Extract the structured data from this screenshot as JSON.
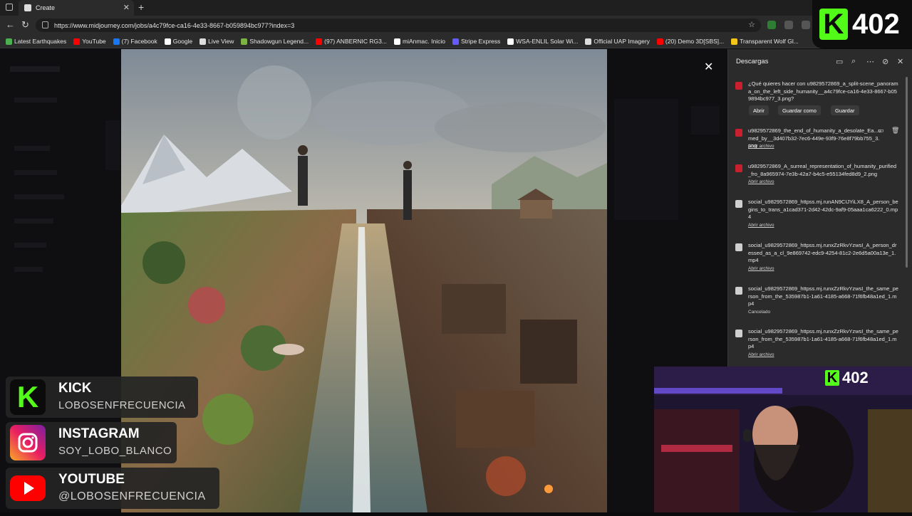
{
  "browser": {
    "tab_title": "Create",
    "url": "https://www.midjourney.com/jobs/a4c79fce-ca16-4e33-8667-b059894bc977?index=3",
    "bookmarks": [
      {
        "label": "Latest Earthquakes",
        "color": "#4caf50"
      },
      {
        "label": "YouTube",
        "color": "#ff0000"
      },
      {
        "label": "(7) Facebook",
        "color": "#1877f2"
      },
      {
        "label": "Google",
        "color": "#ffffff"
      },
      {
        "label": "Live View",
        "color": "#dddddd"
      },
      {
        "label": "Shadowgun Legend...",
        "color": "#7cb342"
      },
      {
        "label": "(97) ANBERNIC RG3...",
        "color": "#ff0000"
      },
      {
        "label": "miAnmac. Inicio",
        "color": "#ffffff"
      },
      {
        "label": "Stripe Express",
        "color": "#635bff"
      },
      {
        "label": "WSA-ENLIL Solar Wi...",
        "color": "#ffffff"
      },
      {
        "label": "Official UAP Imagery",
        "color": "#dddddd"
      },
      {
        "label": "(20) Demo 3D[SBS]...",
        "color": "#ff0000"
      },
      {
        "label": "Transparent Wolf Gl...",
        "color": "#f5c518"
      }
    ]
  },
  "overlay_top_right": {
    "count": "402",
    "letter": "K"
  },
  "downloads": {
    "title": "Descargas",
    "items": [
      {
        "name": "¿Qué quieres hacer con u9829572869_a_split-scene_panorama_on_the_left_side_humanity__a4c79fce-ca16-4e33-8667-b059894bc977_3.png?",
        "buttons": [
          "Abrir",
          "Guardar como",
          "Guardar"
        ]
      },
      {
        "name": "u9829572869_the_end_of_humanity_a_desolate_Ea...umed_by__3d407b32-7ec6-449e-93f9-76e8f79bb755_3.png",
        "sub": "Abrir archivo"
      },
      {
        "name": "u9829572869_A_surreal_representation_of_humanity_purified_fro_8a965974-7e3b-42a7-b4c5-e55134fed8d9_2.png",
        "sub": "Abrir archivo"
      },
      {
        "name": "social_u9829572869_httpss.mj.runAN9CIJYiLX8_A_person_begins_to_trans_a1cad371-2d42-42dc-9af9-05aaa1ca6222_0.mp4",
        "sub": "Abrir archivo"
      },
      {
        "name": "social_u9829572869_httpss.mj.runxZzRkvYzwsI_A_person_dressed_as_a_cl_9e869742-edc9-4254-81c2-2e6d5a00a13e_1.mp4",
        "sub": "Abrir archivo"
      },
      {
        "name": "social_u9829572869_httpss.mj.runxZzRkvYzwsI_the_same_person_from_the_535987b1-1a61-4185-a668-71f6fb48a1ed_1.mp4",
        "sub": "Cancelado"
      },
      {
        "name": "social_u9829572869_httpss.mj.runxZzRkvYzwsI_the_same_person_from_the_535987b1-1a61-4185-a668-71f6fb48a1ed_1.mp4",
        "sub": "Abrir archivo"
      }
    ]
  },
  "social": [
    {
      "platform": "KICK",
      "handle": "LOBOSENFRECUENCIA"
    },
    {
      "platform": "INSTAGRAM",
      "handle": "SOY_LOBO_BLANCO"
    },
    {
      "platform": "YOUTUBE",
      "handle": "@LOBOSENFRECUENCIA"
    }
  ],
  "webcam_tag": {
    "letter": "K",
    "count": "402"
  },
  "colors": {
    "kick_green": "#53fc18",
    "panel": "#2b2b2b",
    "youtube_red": "#ff0000"
  }
}
